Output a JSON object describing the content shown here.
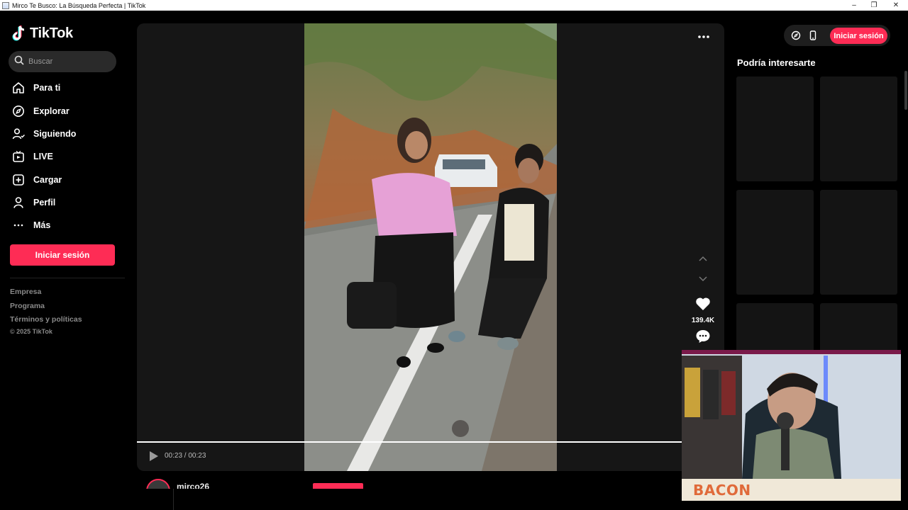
{
  "window": {
    "title": "Mirco Te Busco: La Búsqueda Perfecta | TikTok"
  },
  "sidebar": {
    "brand": "TikTok",
    "search": {
      "placeholder": "Buscar"
    },
    "nav": [
      {
        "label": "Para ti",
        "icon": "home-icon"
      },
      {
        "label": "Explorar",
        "icon": "compass-icon"
      },
      {
        "label": "Siguiendo",
        "icon": "following-icon"
      },
      {
        "label": "LIVE",
        "icon": "live-icon"
      },
      {
        "label": "Cargar",
        "icon": "upload-icon"
      },
      {
        "label": "Perfil",
        "icon": "profile-icon"
      },
      {
        "label": "Más",
        "icon": "more-icon"
      }
    ],
    "login_label": "Iniciar sesión",
    "footer_links": [
      "Empresa",
      "Programa",
      "Términos y políticas"
    ],
    "copyright": "© 2025 TikTok"
  },
  "video": {
    "time": "00:23 / 00:23",
    "progress": 1.0,
    "likes": "139.4K",
    "author": "mirco26"
  },
  "header": {
    "login_label": "Iniciar sesión"
  },
  "recommendations": {
    "title": "Podría interesarte"
  },
  "webcam": {
    "banner_text": "BACON"
  },
  "colors": {
    "accent": "#fe2c55",
    "background": "#000000",
    "panel": "#161616"
  }
}
